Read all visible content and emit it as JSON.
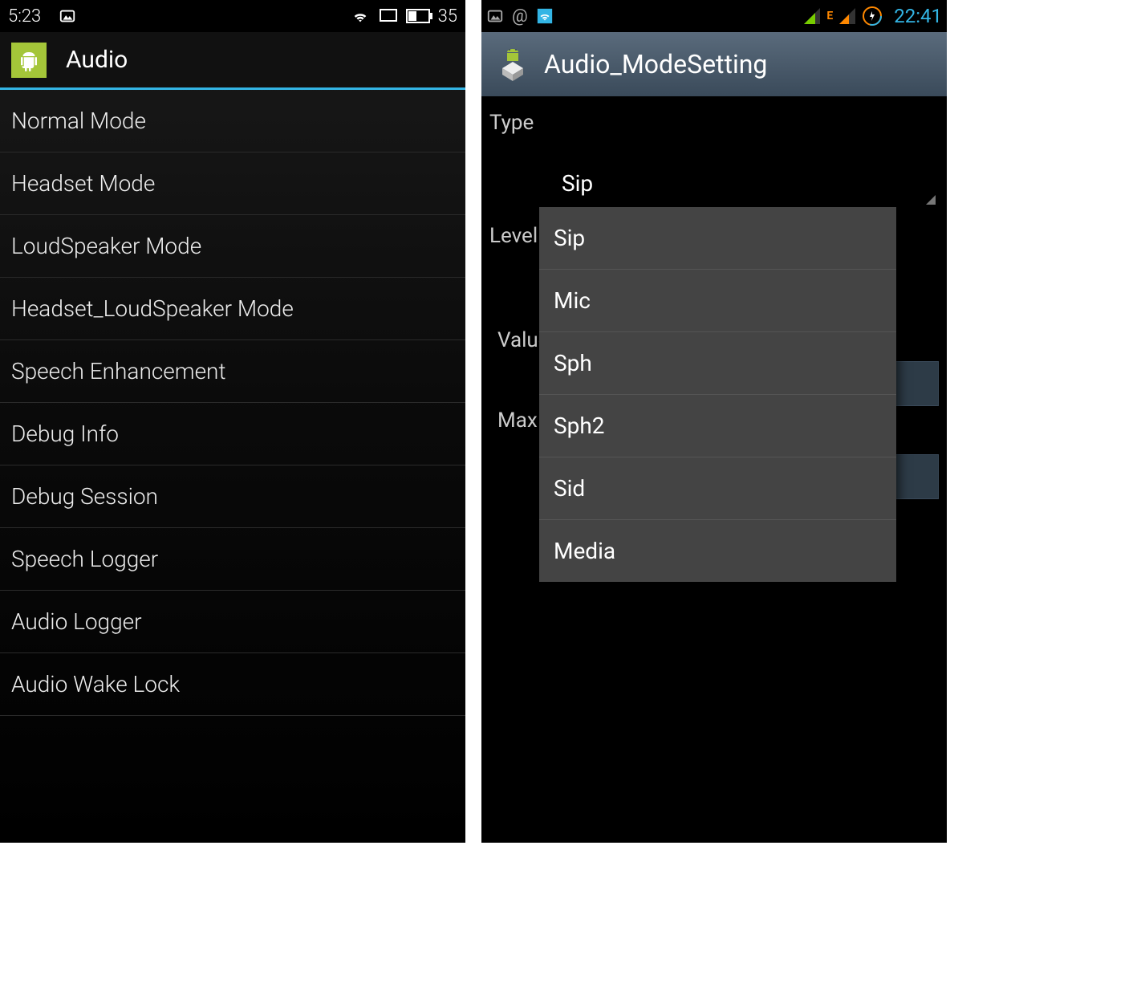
{
  "left": {
    "statusbar": {
      "time": "5:23",
      "battery_text": "35"
    },
    "appbar": {
      "title": "Audio"
    },
    "list": [
      "Normal Mode",
      "Headset Mode",
      "LoudSpeaker Mode",
      "Headset_LoudSpeaker Mode",
      "Speech Enhancement",
      "Debug Info",
      "Debug Session",
      "Speech Logger",
      "Audio Logger",
      "Audio Wake Lock"
    ]
  },
  "right": {
    "statusbar": {
      "clock": "22:41",
      "network_badge": "E"
    },
    "appbar": {
      "title": "Audio_ModeSetting"
    },
    "labels": {
      "type": "Type",
      "level": "Level",
      "value": "Value",
      "max": "Max"
    },
    "spinner_selected": "Sip",
    "dropdown": [
      "Sip",
      "Mic",
      "Sph",
      "Sph2",
      "Sid",
      "Media"
    ]
  }
}
